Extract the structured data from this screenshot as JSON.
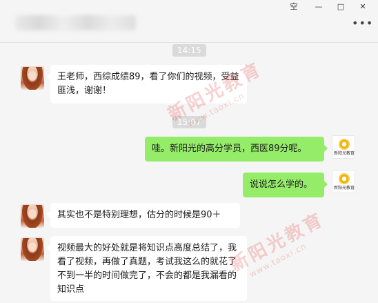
{
  "window": {
    "controls": {
      "pin": "空",
      "minimize": "—",
      "maximize": "□",
      "close": "✕"
    },
    "more": "•••"
  },
  "chat": {
    "time_1": "14:15",
    "time_2": "15:07",
    "messages": [
      {
        "side": "left",
        "text": "王老师，西综成绩89，看了你们的视频，受益匪浅，谢谢！"
      },
      {
        "side": "right",
        "text": "哇。新阳光的高分学员，西医89分呢。"
      },
      {
        "side": "right",
        "text": "说说怎么学的。"
      },
      {
        "side": "left",
        "text": "其实也不是特别理想，估分的时候是90＋"
      },
      {
        "side": "left",
        "text": "视频最大的好处就是将知识点高度总结了，我看了视频，再做了真题，考试我这么的就花了不到一半的时间做完了，不会的都是我漏看的知识点"
      }
    ],
    "logo_text": "新阳光教育"
  },
  "watermark": {
    "name": "新阳光教育",
    "url": "www.taoxi.cn"
  },
  "colors": {
    "sent_bubble": "#95ec69",
    "received_bubble": "#ffffff",
    "background": "#f5f5f5"
  }
}
